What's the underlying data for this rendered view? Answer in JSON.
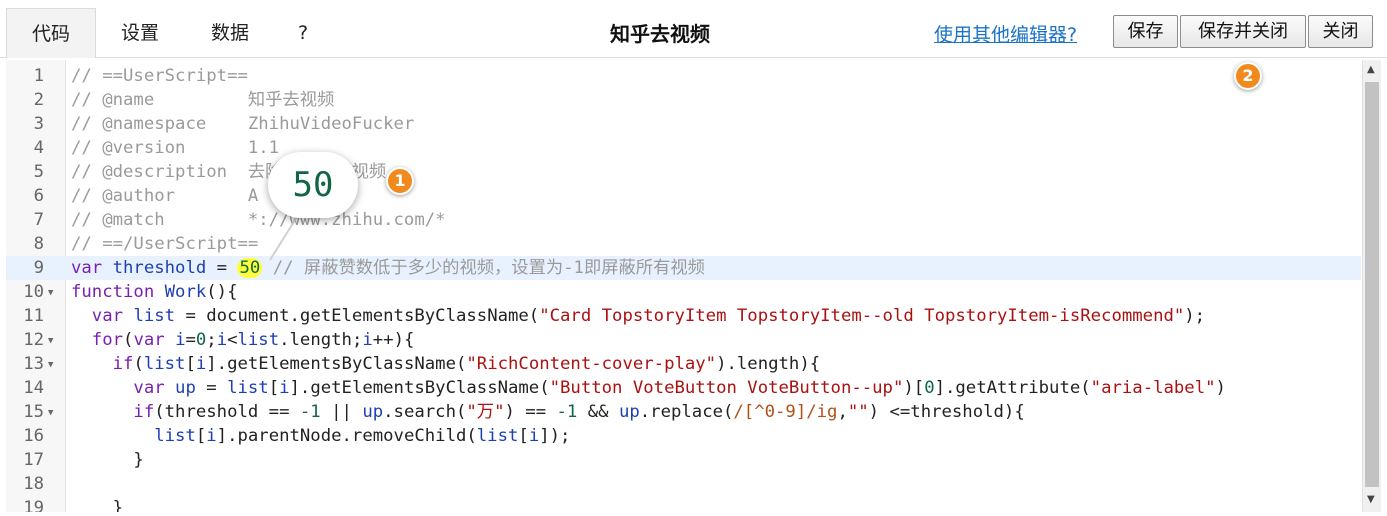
{
  "toolbar": {
    "tabs": [
      {
        "label": "代码",
        "active": true
      },
      {
        "label": "设置",
        "active": false
      },
      {
        "label": "数据",
        "active": false
      },
      {
        "label": "?",
        "active": false
      }
    ],
    "title": "知乎去视频",
    "other_editor_link": "使用其他编辑器?",
    "save_label": "保存",
    "save_close_label": "保存并关闭",
    "close_label": "关闭"
  },
  "editor": {
    "lines": [
      {
        "no": "1",
        "fold": false,
        "tokens": [
          {
            "t": "// ==UserScript==",
            "c": "c"
          }
        ]
      },
      {
        "no": "2",
        "fold": false,
        "tokens": [
          {
            "t": "// @name         知乎去视频",
            "c": "c"
          }
        ]
      },
      {
        "no": "3",
        "fold": false,
        "tokens": [
          {
            "t": "// @namespace    ZhihuVideoFucker",
            "c": "c"
          }
        ]
      },
      {
        "no": "4",
        "fold": false,
        "tokens": [
          {
            "t": "// @version      1.1",
            "c": "c"
          }
        ]
      },
      {
        "no": "5",
        "fold": false,
        "tokens": [
          {
            "t": "// @description  去除知乎营销视频",
            "c": "c"
          }
        ]
      },
      {
        "no": "6",
        "fold": false,
        "tokens": [
          {
            "t": "// @author       A",
            "c": "c"
          }
        ]
      },
      {
        "no": "7",
        "fold": false,
        "tokens": [
          {
            "t": "// @match        *://www.zhihu.com/*",
            "c": "c"
          }
        ]
      },
      {
        "no": "8",
        "fold": false,
        "tokens": [
          {
            "t": "// ==/UserScript==",
            "c": "c"
          }
        ]
      },
      {
        "no": "9",
        "fold": false,
        "highlight": true,
        "tokens": [
          {
            "t": "var ",
            "c": "k"
          },
          {
            "t": "threshold",
            "c": "v"
          },
          {
            "t": " = ",
            "c": "p"
          },
          {
            "t": "50",
            "c": "n hlnum"
          },
          {
            "t": " // 屏蔽赞数低于多少的视频，设置为-1即屏蔽所有视频",
            "c": "c"
          }
        ]
      },
      {
        "no": "10",
        "fold": true,
        "tokens": [
          {
            "t": "function ",
            "c": "k"
          },
          {
            "t": "Work",
            "c": "v"
          },
          {
            "t": "(){",
            "c": "p"
          }
        ]
      },
      {
        "no": "11",
        "fold": false,
        "tokens": [
          {
            "t": "  var ",
            "c": "k"
          },
          {
            "t": "list",
            "c": "v"
          },
          {
            "t": " = document.getElementsByClassName(",
            "c": "p"
          },
          {
            "t": "\"Card TopstoryItem TopstoryItem--old TopstoryItem-isRecommend\"",
            "c": "s"
          },
          {
            "t": ");",
            "c": "p"
          }
        ]
      },
      {
        "no": "12",
        "fold": true,
        "tokens": [
          {
            "t": "  for",
            "c": "k"
          },
          {
            "t": "(",
            "c": "p"
          },
          {
            "t": "var ",
            "c": "k"
          },
          {
            "t": "i",
            "c": "v"
          },
          {
            "t": "=",
            "c": "p"
          },
          {
            "t": "0",
            "c": "n"
          },
          {
            "t": ";",
            "c": "p"
          },
          {
            "t": "i",
            "c": "v"
          },
          {
            "t": "<",
            "c": "p"
          },
          {
            "t": "list",
            "c": "v"
          },
          {
            "t": ".length;",
            "c": "p"
          },
          {
            "t": "i",
            "c": "v"
          },
          {
            "t": "++){",
            "c": "p"
          }
        ]
      },
      {
        "no": "13",
        "fold": true,
        "tokens": [
          {
            "t": "    if",
            "c": "k"
          },
          {
            "t": "(",
            "c": "p"
          },
          {
            "t": "list",
            "c": "v"
          },
          {
            "t": "[",
            "c": "p"
          },
          {
            "t": "i",
            "c": "v"
          },
          {
            "t": "].getElementsByClassName(",
            "c": "p"
          },
          {
            "t": "\"RichContent-cover-play\"",
            "c": "s"
          },
          {
            "t": ").length){",
            "c": "p"
          }
        ]
      },
      {
        "no": "14",
        "fold": false,
        "tokens": [
          {
            "t": "      var ",
            "c": "k"
          },
          {
            "t": "up",
            "c": "v"
          },
          {
            "t": " = ",
            "c": "p"
          },
          {
            "t": "list",
            "c": "v"
          },
          {
            "t": "[",
            "c": "p"
          },
          {
            "t": "i",
            "c": "v"
          },
          {
            "t": "].getElementsByClassName(",
            "c": "p"
          },
          {
            "t": "\"Button VoteButton VoteButton--up\"",
            "c": "s"
          },
          {
            "t": ")[",
            "c": "p"
          },
          {
            "t": "0",
            "c": "n"
          },
          {
            "t": "].getAttribute(",
            "c": "p"
          },
          {
            "t": "\"aria-label\"",
            "c": "s"
          },
          {
            "t": ")",
            "c": "p"
          }
        ]
      },
      {
        "no": "15",
        "fold": true,
        "tokens": [
          {
            "t": "      if",
            "c": "k"
          },
          {
            "t": "(threshold == ",
            "c": "p"
          },
          {
            "t": "-1",
            "c": "n"
          },
          {
            "t": " || ",
            "c": "p"
          },
          {
            "t": "up",
            "c": "v"
          },
          {
            "t": ".search(",
            "c": "p"
          },
          {
            "t": "\"万\"",
            "c": "s"
          },
          {
            "t": ") == ",
            "c": "p"
          },
          {
            "t": "-1",
            "c": "n"
          },
          {
            "t": " && ",
            "c": "p"
          },
          {
            "t": "up",
            "c": "v"
          },
          {
            "t": ".replace(",
            "c": "p"
          },
          {
            "t": "/[^0-9]/ig",
            "c": "r"
          },
          {
            "t": ",",
            "c": "p"
          },
          {
            "t": "\"\"",
            "c": "s"
          },
          {
            "t": ") <=threshold){",
            "c": "p"
          }
        ]
      },
      {
        "no": "16",
        "fold": false,
        "tokens": [
          {
            "t": "        list",
            "c": "v"
          },
          {
            "t": "[",
            "c": "p"
          },
          {
            "t": "i",
            "c": "v"
          },
          {
            "t": "].parentNode.removeChild(",
            "c": "p"
          },
          {
            "t": "list",
            "c": "v"
          },
          {
            "t": "[",
            "c": "p"
          },
          {
            "t": "i",
            "c": "v"
          },
          {
            "t": "]);",
            "c": "p"
          }
        ]
      },
      {
        "no": "17",
        "fold": false,
        "tokens": [
          {
            "t": "      }",
            "c": "p"
          }
        ]
      },
      {
        "no": "18",
        "fold": false,
        "tokens": []
      },
      {
        "no": "19",
        "fold": false,
        "tokens": [
          {
            "t": "    }",
            "c": "p"
          }
        ]
      }
    ]
  },
  "annotations": {
    "zoom_value": "50",
    "badge_1": "1",
    "badge_2": "2"
  },
  "colors": {
    "accent_badge": "#f08a1c",
    "link": "#1a73c8",
    "highlight_line": "#e8f2ff",
    "highlight_number": "#ffff3c"
  }
}
